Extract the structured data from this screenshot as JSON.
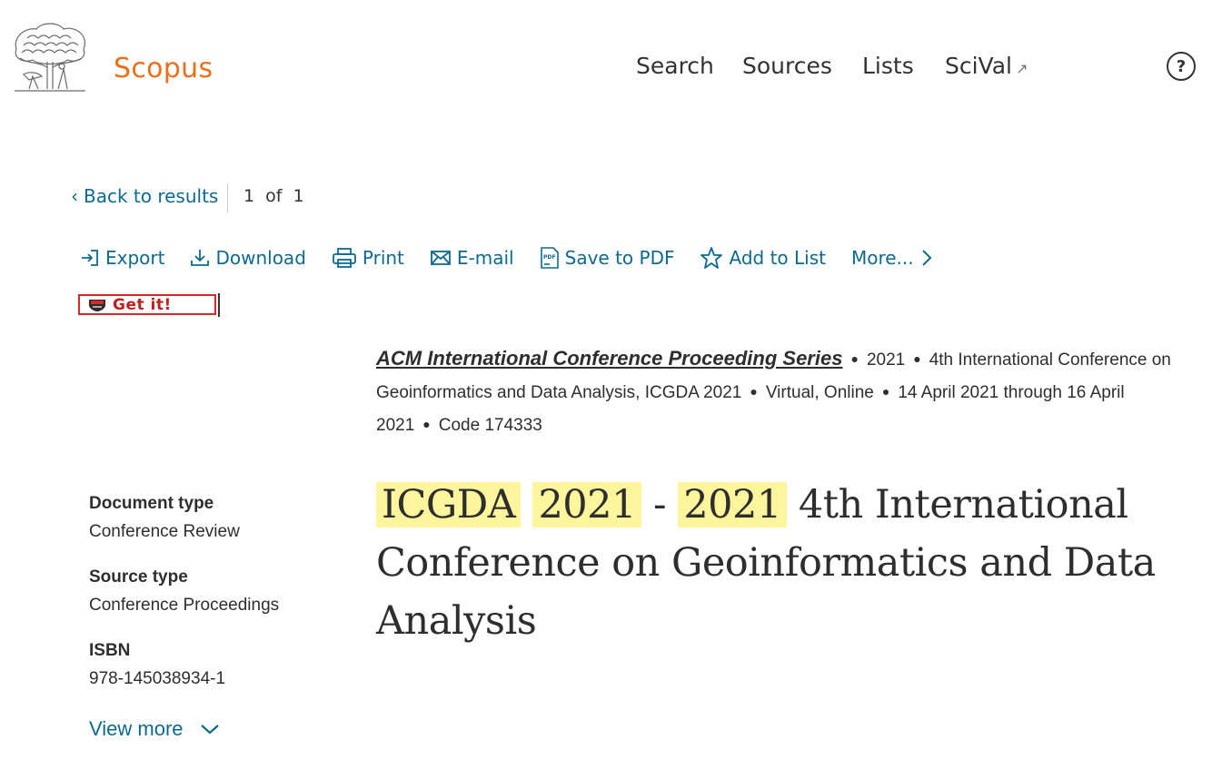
{
  "header": {
    "brand": "Scopus",
    "nav": [
      {
        "label": "Search"
      },
      {
        "label": "Sources"
      },
      {
        "label": "Lists"
      },
      {
        "label": "SciVal",
        "external_icon": "↗"
      }
    ],
    "help_label": "?"
  },
  "results_nav": {
    "back_label": "Back to results",
    "position": "1",
    "of_label": "of",
    "total": "1"
  },
  "toolbar": [
    {
      "label": "Export",
      "icon": "export-icon"
    },
    {
      "label": "Download",
      "icon": "download-icon"
    },
    {
      "label": "Print",
      "icon": "print-icon"
    },
    {
      "label": "E-mail",
      "icon": "email-icon"
    },
    {
      "label": "Save to PDF",
      "icon": "pdf-icon"
    },
    {
      "label": "Add to List",
      "icon": "star-icon"
    },
    {
      "label": "More...",
      "icon": "chevron-right-icon"
    }
  ],
  "getit": {
    "label": "Get it!"
  },
  "source": {
    "series": "ACM International Conference Proceeding Series",
    "year": "2021",
    "conference": "4th International Conference on Geoinformatics and Data Analysis, ICGDA 2021",
    "location": "Virtual, Online",
    "dates": "14 April 2021 through 16 April 2021",
    "code": "Code 174333"
  },
  "title": {
    "part1": "ICGDA",
    "part2": "2021",
    "dash": "-",
    "part3": "2021",
    "rest": "4th International Conference on Geoinformatics and Data Analysis"
  },
  "metadata": {
    "document_type_label": "Document type",
    "document_type": "Conference Review",
    "source_type_label": "Source type",
    "source_type": "Conference Proceedings",
    "isbn_label": "ISBN",
    "isbn": "978-145038934-1",
    "view_more": "View more"
  },
  "colors": {
    "brand": "#e9711c",
    "link": "#0d6a8e",
    "highlight": "#fff59d",
    "getit_border": "#d42a2a"
  }
}
